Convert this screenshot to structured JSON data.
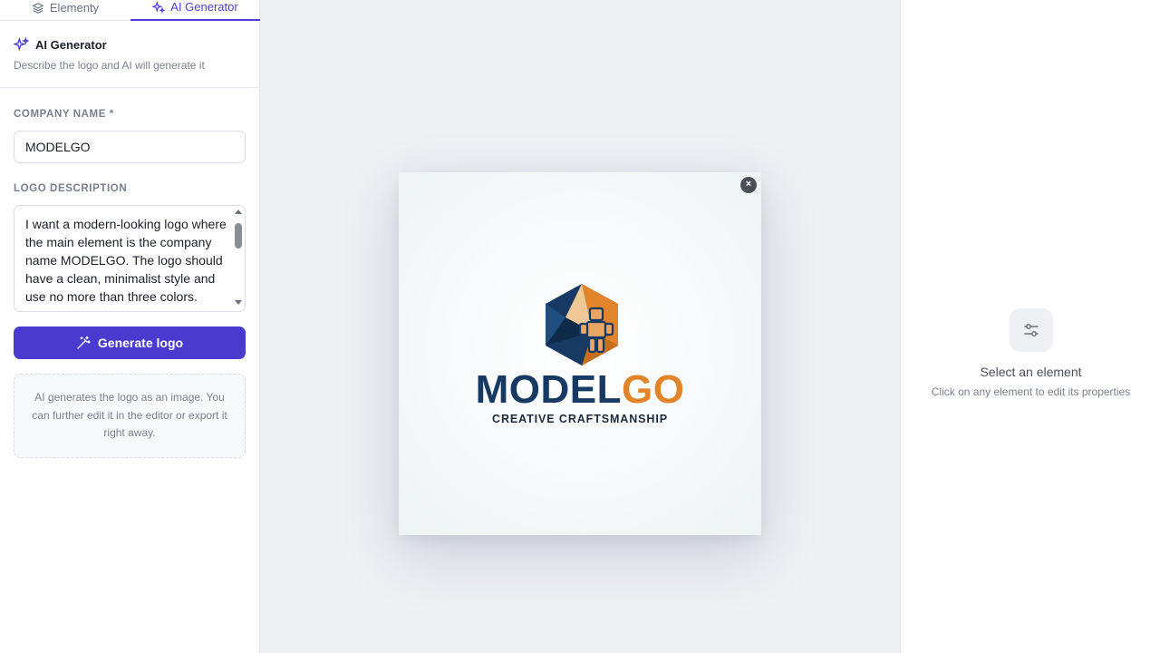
{
  "tabs": [
    {
      "label": "Elementy",
      "icon": "layers-icon"
    },
    {
      "label": "AI Generator",
      "icon": "sparkles-icon"
    }
  ],
  "generator": {
    "title": "AI Generator",
    "subtitle": "Describe the logo and AI will generate it",
    "company_label": "COMPANY NAME *",
    "company_value": "MODELGO",
    "description_label": "LOGO DESCRIPTION",
    "description_value": "I want a modern-looking logo where the main element is the company name MODELGO. The logo should have a clean, minimalist style and use no more than three colors.",
    "generate_button": "Generate logo",
    "info": "AI generates the logo as an image. You can further edit it in the editor or export it right away."
  },
  "canvas": {
    "close_icon": "close-icon",
    "close_glyph": "×",
    "brand_part1": "MODEL",
    "brand_part2": "GO",
    "tagline": "CREATIVE CRAFTSMANSHIP",
    "colors": {
      "navy": "#163a63",
      "orange": "#e2842a"
    }
  },
  "properties": {
    "icon": "sliders-icon",
    "title": "Select an element",
    "subtitle": "Click on any element to edit its properties"
  },
  "colors": {
    "accent": "#4a3bd0"
  }
}
